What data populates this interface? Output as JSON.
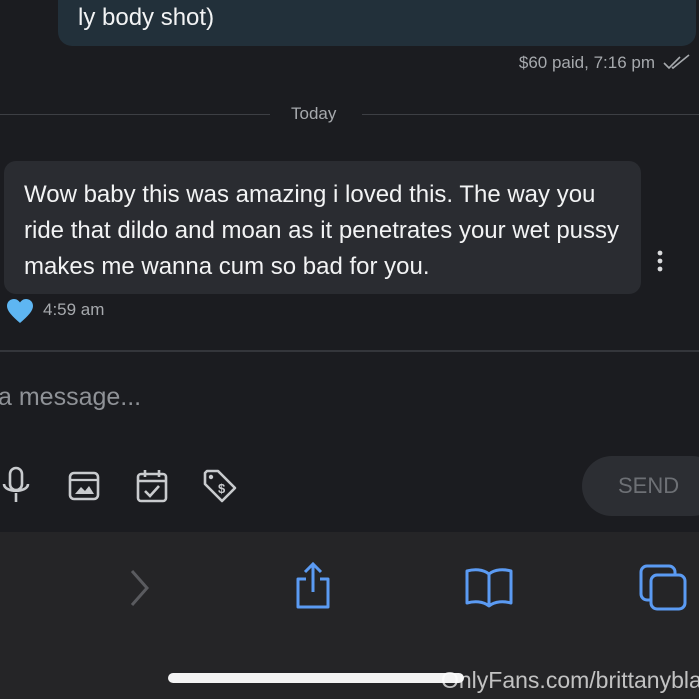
{
  "conversation": {
    "outgoing_message": {
      "text": "ly body shot)",
      "meta": "$60 paid, 7:16 pm"
    },
    "day_separator": "Today",
    "incoming_message": {
      "text": "Wow baby this was amazing i loved this. The way you ride that dildo and moan as it penetrates your wet pussy makes me wanna cum so bad for you.",
      "time": "4:59 am",
      "reaction": "heart-icon"
    }
  },
  "composer": {
    "placeholder": "a message...",
    "tools": [
      "microphone-icon",
      "image-icon",
      "calendar-check-icon",
      "price-tag-icon"
    ],
    "send_label": "SEND"
  },
  "browser": {
    "buttons": [
      "forward-icon",
      "share-icon",
      "bookmarks-icon",
      "tabs-icon"
    ]
  },
  "watermark": "OnlyFans.com/brittanyblair",
  "colors": {
    "background": "#1b1c20",
    "outgoing_bubble": "#22303a",
    "incoming_bubble": "#2a2c31",
    "accent_blue": "#5b9bf3",
    "heart": "#5eb6f2",
    "browser_bar": "#252527"
  }
}
